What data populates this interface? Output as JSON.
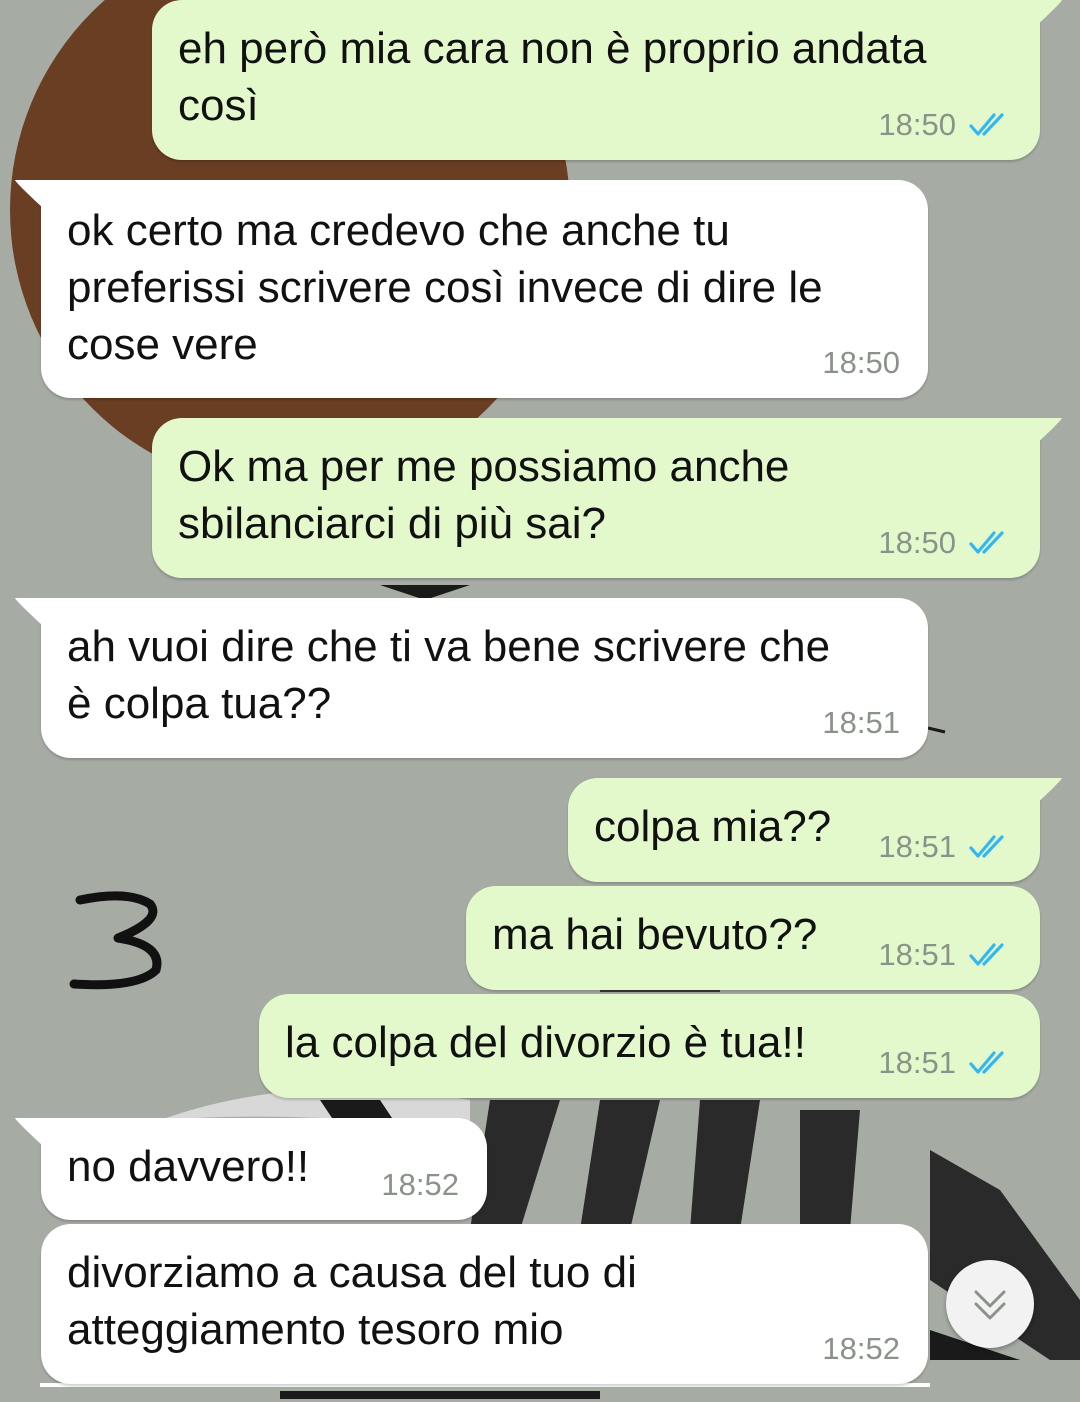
{
  "messages": [
    {
      "direction": "out",
      "text": "eh però mia cara non è proprio andata\ncosì",
      "time": "18:50",
      "status": "read"
    },
    {
      "direction": "in",
      "text": "ok certo ma credevo che anche tu\npreferissi scrivere così invece di dire le\ncose vere",
      "time": "18:50"
    },
    {
      "direction": "out",
      "text": "Ok ma per me possiamo anche\nsbilanciarci di più sai?",
      "time": "18:50",
      "status": "read"
    },
    {
      "direction": "in",
      "text": "ah vuoi dire che ti va bene scrivere che\nè colpa tua??",
      "time": "18:51"
    },
    {
      "direction": "out",
      "text": "colpa mia??",
      "time": "18:51",
      "status": "read"
    },
    {
      "direction": "out",
      "text": "ma hai bevuto??",
      "time": "18:51",
      "status": "read"
    },
    {
      "direction": "out",
      "text": "la colpa del divorzio è tua!!",
      "time": "18:51",
      "status": "read"
    },
    {
      "direction": "in",
      "text": "no davvero!!",
      "time": "18:52"
    },
    {
      "direction": "in",
      "text": "divorziamo a causa del tuo di\natteggiamento tesoro mio",
      "time": "18:52"
    }
  ],
  "annotation": "3",
  "colors": {
    "outgoing_bubble": "#e3f9cc",
    "incoming_bubble": "#ffffff",
    "read_ticks": "#34b7f1",
    "timestamp": "#8a9389",
    "wallpaper": "#a6aca4"
  },
  "icons": {
    "read_status": "double-check-icon",
    "scroll_down": "double-chevron-down-icon"
  }
}
